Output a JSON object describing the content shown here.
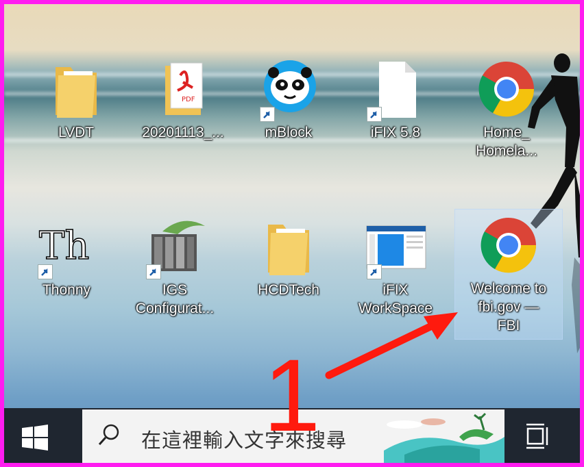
{
  "desktop": {
    "icons": [
      {
        "name": "LVDT",
        "type": "folder",
        "shortcut": false
      },
      {
        "name": "20201113_...",
        "type": "pdf",
        "shortcut": false
      },
      {
        "name": "mBlock",
        "type": "app-mblock",
        "shortcut": true
      },
      {
        "name": "iFIX 5.8",
        "type": "file",
        "shortcut": true
      },
      {
        "name": "Home_\nHomela...",
        "type": "chrome",
        "shortcut": false
      },
      {
        "name": "Thonny",
        "type": "app-thonny",
        "shortcut": true
      },
      {
        "name": "IGS\nConfigurat...",
        "type": "app-igs",
        "shortcut": true
      },
      {
        "name": "HCDTech",
        "type": "folder",
        "shortcut": false
      },
      {
        "name": "iFIX\nWorkSpace",
        "type": "app-window",
        "shortcut": true
      },
      {
        "name": "Welcome to\nfbi.gov —\nFBI",
        "type": "chrome",
        "shortcut": false,
        "selected": true
      }
    ]
  },
  "taskbar": {
    "search_placeholder": "在這裡輸入文字來搜尋"
  },
  "annotation": {
    "number": "1",
    "color": "#ff1a0e"
  },
  "frame_color": "#ff1cf0"
}
